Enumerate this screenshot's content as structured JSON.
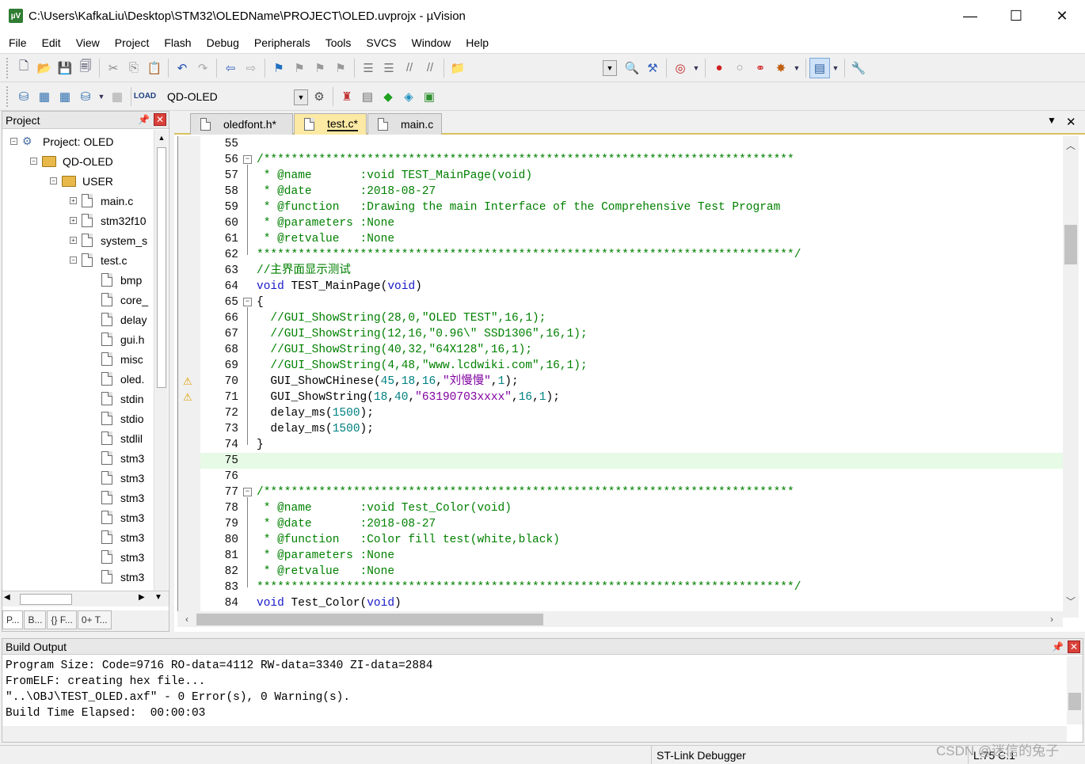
{
  "window": {
    "title": "C:\\Users\\KafkaLiu\\Desktop\\STM32\\OLEDName\\PROJECT\\OLED.uvprojx - µVision",
    "minimize": "—",
    "maximize": "☐",
    "close": "✕"
  },
  "menu": [
    "File",
    "Edit",
    "View",
    "Project",
    "Flash",
    "Debug",
    "Peripherals",
    "Tools",
    "SVCS",
    "Window",
    "Help"
  ],
  "toolbar": {
    "target": "QD-OLED"
  },
  "project_panel": {
    "title": "Project",
    "tree": [
      {
        "label": "Project: OLED",
        "kind": "project",
        "expander": "−",
        "indent": 0
      },
      {
        "label": "QD-OLED",
        "kind": "target",
        "expander": "−",
        "indent": 1
      },
      {
        "label": "USER",
        "kind": "folder",
        "expander": "−",
        "indent": 2
      },
      {
        "label": "main.c",
        "kind": "file",
        "expander": "+",
        "indent": 3
      },
      {
        "label": "stm32f10",
        "kind": "file",
        "expander": "+",
        "indent": 3
      },
      {
        "label": "system_s",
        "kind": "file",
        "expander": "+",
        "indent": 3
      },
      {
        "label": "test.c",
        "kind": "file",
        "expander": "−",
        "indent": 3
      },
      {
        "label": "bmp",
        "kind": "file",
        "expander": "",
        "indent": 4
      },
      {
        "label": "core_",
        "kind": "file",
        "expander": "",
        "indent": 4
      },
      {
        "label": "delay",
        "kind": "file",
        "expander": "",
        "indent": 4
      },
      {
        "label": "gui.h",
        "kind": "file",
        "expander": "",
        "indent": 4
      },
      {
        "label": "misc",
        "kind": "file",
        "expander": "",
        "indent": 4
      },
      {
        "label": "oled.",
        "kind": "file",
        "expander": "",
        "indent": 4
      },
      {
        "label": "stdin",
        "kind": "file",
        "expander": "",
        "indent": 4
      },
      {
        "label": "stdio",
        "kind": "file",
        "expander": "",
        "indent": 4
      },
      {
        "label": "stdlil",
        "kind": "file",
        "expander": "",
        "indent": 4
      },
      {
        "label": "stm3",
        "kind": "file",
        "expander": "",
        "indent": 4
      },
      {
        "label": "stm3",
        "kind": "file",
        "expander": "",
        "indent": 4
      },
      {
        "label": "stm3",
        "kind": "file",
        "expander": "",
        "indent": 4
      },
      {
        "label": "stm3",
        "kind": "file",
        "expander": "",
        "indent": 4
      },
      {
        "label": "stm3",
        "kind": "file",
        "expander": "",
        "indent": 4
      },
      {
        "label": "stm3",
        "kind": "file",
        "expander": "",
        "indent": 4
      },
      {
        "label": "stm3",
        "kind": "file",
        "expander": "",
        "indent": 4
      }
    ],
    "bottom_tabs": [
      "P...",
      "B...",
      "{} F...",
      "0+ T..."
    ]
  },
  "editor": {
    "tabs": [
      {
        "label": "oledfont.h*",
        "active": false
      },
      {
        "label": "test.c*",
        "active": true
      },
      {
        "label": "main.c",
        "active": false
      }
    ],
    "current_line": "75",
    "lines": [
      {
        "n": "55",
        "seg": []
      },
      {
        "n": "56",
        "fold": "−",
        "seg": [
          {
            "t": "/*****************************************************************************",
            "c": "comment"
          }
        ]
      },
      {
        "n": "57",
        "seg": [
          {
            "t": " * @name       :void TEST_MainPage(void)",
            "c": "comment"
          }
        ]
      },
      {
        "n": "58",
        "seg": [
          {
            "t": " * @date       :2018-08-27",
            "c": "comment"
          }
        ]
      },
      {
        "n": "59",
        "seg": [
          {
            "t": " * @function   :Drawing the main Interface of the Comprehensive Test Program",
            "c": "comment"
          }
        ]
      },
      {
        "n": "60",
        "seg": [
          {
            "t": " * @parameters :None",
            "c": "comment"
          }
        ]
      },
      {
        "n": "61",
        "seg": [
          {
            "t": " * @retvalue   :None",
            "c": "comment"
          }
        ]
      },
      {
        "n": "62",
        "seg": [
          {
            "t": "******************************************************************************/",
            "c": "comment"
          }
        ]
      },
      {
        "n": "63",
        "seg": [
          {
            "t": "//主界面显示测试",
            "c": "comment"
          }
        ]
      },
      {
        "n": "64",
        "seg": [
          {
            "t": "void",
            "c": "key"
          },
          {
            "t": " TEST_MainPage(",
            "c": ""
          },
          {
            "t": "void",
            "c": "key"
          },
          {
            "t": ")",
            "c": ""
          }
        ]
      },
      {
        "n": "65",
        "fold": "−",
        "seg": [
          {
            "t": "{",
            "c": ""
          }
        ]
      },
      {
        "n": "66",
        "seg": [
          {
            "t": "  //GUI_ShowString(28,0,\"OLED TEST\",16,1);",
            "c": "comment"
          }
        ]
      },
      {
        "n": "67",
        "seg": [
          {
            "t": "  //GUI_ShowString(12,16,\"0.96\\\" SSD1306\",16,1);",
            "c": "comment"
          }
        ]
      },
      {
        "n": "68",
        "seg": [
          {
            "t": "  //GUI_ShowString(40,32,\"64X128\",16,1);",
            "c": "comment"
          }
        ]
      },
      {
        "n": "69",
        "seg": [
          {
            "t": "  //GUI_ShowString(4,48,\"www.lcdwiki.com\",16,1);",
            "c": "comment"
          }
        ]
      },
      {
        "n": "70",
        "warn": true,
        "seg": [
          {
            "t": "  GUI_ShowCHinese(",
            "c": ""
          },
          {
            "t": "45",
            "c": "num"
          },
          {
            "t": ",",
            "c": ""
          },
          {
            "t": "18",
            "c": "num"
          },
          {
            "t": ",",
            "c": ""
          },
          {
            "t": "16",
            "c": "num"
          },
          {
            "t": ",",
            "c": ""
          },
          {
            "t": "\"刘慢慢\"",
            "c": "str"
          },
          {
            "t": ",",
            "c": ""
          },
          {
            "t": "1",
            "c": "num"
          },
          {
            "t": ");",
            "c": ""
          }
        ]
      },
      {
        "n": "71",
        "warn": true,
        "seg": [
          {
            "t": "  GUI_ShowString(",
            "c": ""
          },
          {
            "t": "18",
            "c": "num"
          },
          {
            "t": ",",
            "c": ""
          },
          {
            "t": "40",
            "c": "num"
          },
          {
            "t": ",",
            "c": ""
          },
          {
            "t": "\"63190703xxxx\"",
            "c": "str"
          },
          {
            "t": ",",
            "c": ""
          },
          {
            "t": "16",
            "c": "num"
          },
          {
            "t": ",",
            "c": ""
          },
          {
            "t": "1",
            "c": "num"
          },
          {
            "t": ");",
            "c": ""
          }
        ]
      },
      {
        "n": "72",
        "seg": [
          {
            "t": "  delay_ms(",
            "c": ""
          },
          {
            "t": "1500",
            "c": "num"
          },
          {
            "t": ");",
            "c": ""
          }
        ]
      },
      {
        "n": "73",
        "seg": [
          {
            "t": "  delay_ms(",
            "c": ""
          },
          {
            "t": "1500",
            "c": "num"
          },
          {
            "t": ");",
            "c": ""
          }
        ]
      },
      {
        "n": "74",
        "seg": [
          {
            "t": "}",
            "c": ""
          }
        ]
      },
      {
        "n": "75",
        "seg": []
      },
      {
        "n": "76",
        "seg": []
      },
      {
        "n": "77",
        "fold": "−",
        "seg": [
          {
            "t": "/*****************************************************************************",
            "c": "comment"
          }
        ]
      },
      {
        "n": "78",
        "seg": [
          {
            "t": " * @name       :void Test_Color(void)",
            "c": "comment"
          }
        ]
      },
      {
        "n": "79",
        "seg": [
          {
            "t": " * @date       :2018-08-27",
            "c": "comment"
          }
        ]
      },
      {
        "n": "80",
        "seg": [
          {
            "t": " * @function   :Color fill test(white,black)",
            "c": "comment"
          }
        ]
      },
      {
        "n": "81",
        "seg": [
          {
            "t": " * @parameters :None",
            "c": "comment"
          }
        ]
      },
      {
        "n": "82",
        "seg": [
          {
            "t": " * @retvalue   :None",
            "c": "comment"
          }
        ]
      },
      {
        "n": "83",
        "seg": [
          {
            "t": "******************************************************************************/",
            "c": "comment"
          }
        ]
      },
      {
        "n": "84",
        "seg": [
          {
            "t": "void",
            "c": "key"
          },
          {
            "t": " Test_Color(",
            "c": ""
          },
          {
            "t": "void",
            "c": "key"
          },
          {
            "t": ")",
            "c": ""
          }
        ]
      }
    ]
  },
  "build_output": {
    "title": "Build Output",
    "lines": [
      "Program Size: Code=9716 RO-data=4112 RW-data=3340 ZI-data=2884",
      "FromELF: creating hex file...",
      "\"..\\OBJ\\TEST_OLED.axf\" - 0 Error(s), 0 Warning(s).",
      "Build Time Elapsed:  00:00:03"
    ]
  },
  "status": {
    "debugger": "ST-Link Debugger",
    "position": "L:75 C:1"
  },
  "watermark": "CSDN @迷信的兔子",
  "colors": {
    "comment": "#008000",
    "keyword": "#1818c8",
    "string": "#8000a0",
    "number": "#008080",
    "current_line": "#e6fae6",
    "active_tab": "#fbe9a4"
  }
}
